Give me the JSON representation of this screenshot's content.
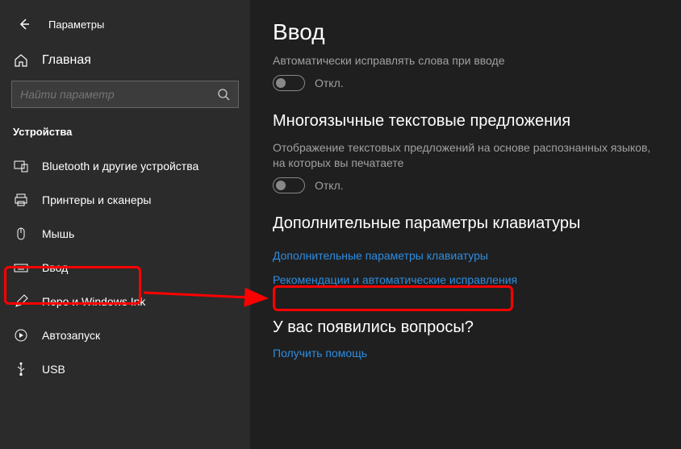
{
  "header": {
    "title": "Параметры"
  },
  "home": {
    "label": "Главная"
  },
  "search": {
    "placeholder": "Найти параметр"
  },
  "section": {
    "label": "Устройства"
  },
  "nav": {
    "bluetooth": "Bluetooth и другие устройства",
    "printers": "Принтеры и сканеры",
    "mouse": "Мышь",
    "typing": "Ввод",
    "pen": "Перо и Windows Ink",
    "autoplay": "Автозапуск",
    "usb": "USB"
  },
  "main": {
    "title": "Ввод",
    "autocorrect": {
      "desc": "Автоматически исправлять слова при вводе",
      "state": "Откл."
    },
    "multilingual": {
      "heading": "Многоязычные текстовые предложения",
      "desc": "Отображение текстовых предложений на основе распознанных языков, на которых вы печатаете",
      "state": "Откл."
    },
    "advanced": {
      "heading": "Дополнительные параметры клавиатуры",
      "link1": "Дополнительные параметры клавиатуры",
      "link2": "Рекомендации и автоматические исправления"
    },
    "help": {
      "heading": "У вас появились вопросы?",
      "link": "Получить помощь"
    }
  }
}
